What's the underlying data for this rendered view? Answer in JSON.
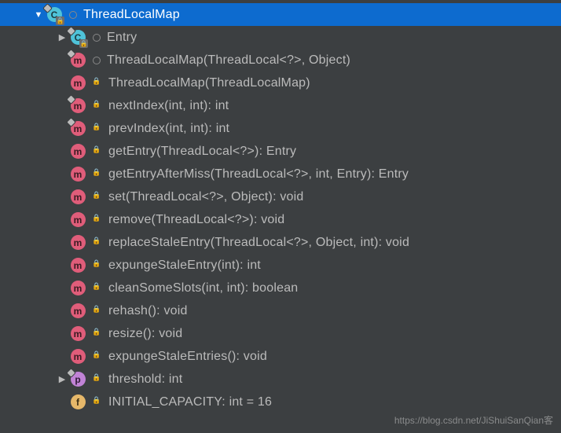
{
  "root": {
    "label": "ThreadLocalMap",
    "icon": "class",
    "visibility": "package",
    "expanded": true,
    "hasDiamond": true,
    "hasLock": true
  },
  "children": [
    {
      "label": "Entry",
      "icon": "class",
      "visibility": "package",
      "arrow": "collapsed",
      "hasDiamond": true,
      "hasLock": true
    },
    {
      "label": "ThreadLocalMap(ThreadLocal<?>, Object)",
      "icon": "method",
      "visibility": "package",
      "hasDiamond": true
    },
    {
      "label": "ThreadLocalMap(ThreadLocalMap)",
      "icon": "method",
      "visibility": "private"
    },
    {
      "label": "nextIndex(int, int): int",
      "icon": "method",
      "visibility": "private",
      "hasDiamond": true
    },
    {
      "label": "prevIndex(int, int): int",
      "icon": "method",
      "visibility": "private",
      "hasDiamond": true
    },
    {
      "label": "getEntry(ThreadLocal<?>): Entry",
      "icon": "method",
      "visibility": "private"
    },
    {
      "label": "getEntryAfterMiss(ThreadLocal<?>, int, Entry): Entry",
      "icon": "method",
      "visibility": "private"
    },
    {
      "label": "set(ThreadLocal<?>, Object): void",
      "icon": "method",
      "visibility": "private"
    },
    {
      "label": "remove(ThreadLocal<?>): void",
      "icon": "method",
      "visibility": "private"
    },
    {
      "label": "replaceStaleEntry(ThreadLocal<?>, Object, int): void",
      "icon": "method",
      "visibility": "private"
    },
    {
      "label": "expungeStaleEntry(int): int",
      "icon": "method",
      "visibility": "private"
    },
    {
      "label": "cleanSomeSlots(int, int): boolean",
      "icon": "method",
      "visibility": "private"
    },
    {
      "label": "rehash(): void",
      "icon": "method",
      "visibility": "private"
    },
    {
      "label": "resize(): void",
      "icon": "method",
      "visibility": "private"
    },
    {
      "label": "expungeStaleEntries(): void",
      "icon": "method",
      "visibility": "private"
    },
    {
      "label": "threshold: int",
      "icon": "field-p",
      "visibility": "private",
      "arrow": "collapsed",
      "hasDiamond": true
    },
    {
      "label": "INITIAL_CAPACITY: int = 16",
      "icon": "field-f",
      "visibility": "private"
    }
  ],
  "watermark": "https://blog.csdn.net/JiShuiSanQian客"
}
